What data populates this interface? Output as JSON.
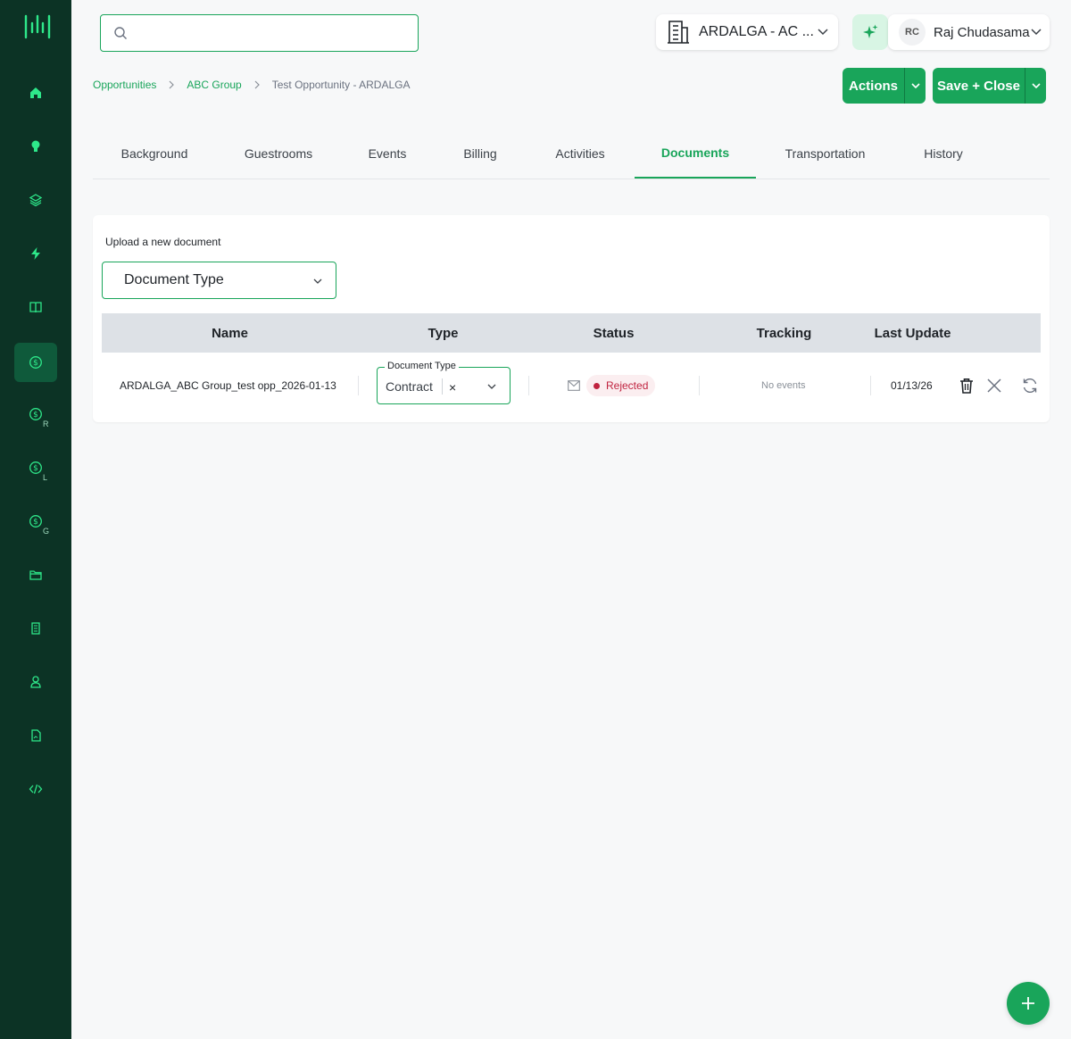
{
  "colors": {
    "brand": "#19a55a",
    "sidebar": "#0c3325",
    "rejected": "#c0233f"
  },
  "sidebar": {
    "logo_icon": "bar-chart-logo",
    "items": [
      {
        "icon": "home-icon"
      },
      {
        "icon": "lightbulb-icon"
      },
      {
        "icon": "layers-icon"
      },
      {
        "icon": "bolt-icon"
      },
      {
        "icon": "book-icon"
      },
      {
        "icon": "dollar-icon",
        "active": true
      },
      {
        "icon": "dollar-icon",
        "sub": "R"
      },
      {
        "icon": "dollar-icon",
        "sub": "L"
      },
      {
        "icon": "dollar-icon",
        "sub": "G"
      },
      {
        "icon": "folder-icon"
      },
      {
        "icon": "building-icon"
      },
      {
        "icon": "user-icon"
      },
      {
        "icon": "file-icon"
      },
      {
        "icon": "code-icon"
      }
    ]
  },
  "search": {
    "placeholder": ""
  },
  "hotel": {
    "name": "ARDALGA - AC ..."
  },
  "user": {
    "initials": "RC",
    "name": "Raj Chudasama"
  },
  "breadcrumb": {
    "items": [
      "Opportunities",
      "ABC Group"
    ],
    "current": "Test Opportunity - ARDALGA"
  },
  "actions": {
    "actions_label": "Actions",
    "save_label": "Save + Close"
  },
  "tabs": [
    {
      "label": "Background"
    },
    {
      "label": "Guestrooms"
    },
    {
      "label": "Events"
    },
    {
      "label": "Billing"
    },
    {
      "label": "Activities"
    },
    {
      "label": "Documents",
      "active": true
    },
    {
      "label": "Transportation"
    },
    {
      "label": "History"
    }
  ],
  "documents": {
    "upload_label": "Upload a new document",
    "document_type_placeholder": "Document Type",
    "columns": [
      "Name",
      "Type",
      "Status",
      "Tracking",
      "Last Update"
    ],
    "rows": [
      {
        "name": "ARDALGA_ABC Group_test opp_2026-01-13",
        "type_legend": "Document Type",
        "type": "Contract",
        "clear": "×",
        "status": "Rejected",
        "tracking": "No events",
        "last_update": "01/13/26"
      }
    ]
  }
}
